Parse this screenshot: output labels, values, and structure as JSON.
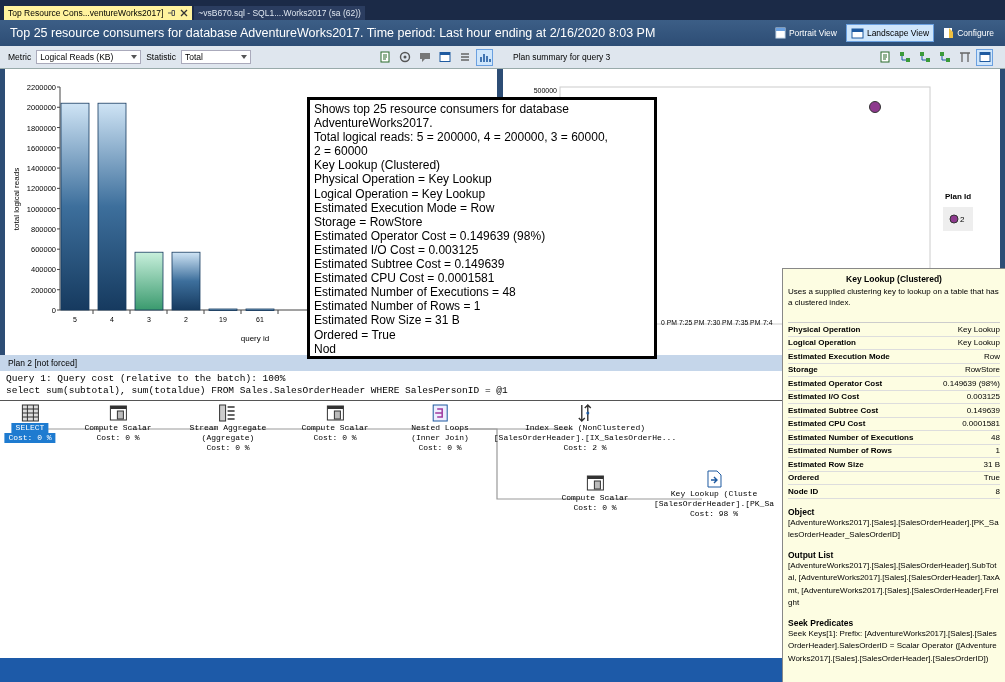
{
  "tabs": [
    {
      "label": "Top Resource Cons...ventureWorks2017]",
      "selected": true,
      "pinned": true,
      "closable": true
    },
    {
      "label": "~vsB670.sql - SQL1....Works2017 (sa (62))",
      "selected": false,
      "pinned": false,
      "closable": false
    }
  ],
  "header": {
    "title": "Top 25 resource consumers for database AdventureWorks2017. Time period: Last hour ending at 2/16/2020 8:03 PM",
    "views": [
      {
        "label": "Portrait View",
        "kind": "portrait",
        "selected": false
      },
      {
        "label": "Landscape View",
        "kind": "landscape",
        "selected": true
      },
      {
        "label": "Configure",
        "kind": "configure",
        "selected": false
      }
    ]
  },
  "toolbar": {
    "metric_label": "Metric",
    "metric_value": "Logical Reads (KB)",
    "statistic_label": "Statistic",
    "statistic_value": "Total",
    "left_tools": [
      {
        "kind": "document",
        "selected": false
      },
      {
        "kind": "target",
        "selected": false
      },
      {
        "kind": "speech",
        "selected": false
      },
      {
        "kind": "window",
        "selected": false
      },
      {
        "kind": "list",
        "selected": false
      },
      {
        "kind": "bar-chart",
        "selected": true
      }
    ],
    "plan_summary_title": "Plan summary for query 3",
    "right_tools": [
      {
        "kind": "document",
        "selected": false
      },
      {
        "kind": "network",
        "selected": false
      },
      {
        "kind": "network",
        "selected": false
      },
      {
        "kind": "network",
        "selected": false
      },
      {
        "kind": "split",
        "selected": false
      },
      {
        "kind": "window",
        "selected": true
      }
    ]
  },
  "bar_panel": {
    "selected_query": "3",
    "chart_data": {
      "type": "bar",
      "xlabel": "query id",
      "ylabel": "total logical reads",
      "categories": [
        "5",
        "4",
        "3",
        "2",
        "19",
        "61"
      ],
      "values": [
        2040000,
        2040000,
        570000,
        570000,
        10000,
        10000
      ],
      "ylim": [
        0,
        2200000
      ],
      "yticks": [
        0,
        200000,
        400000,
        600000,
        800000,
        1000000,
        1200000,
        1400000,
        1600000,
        1800000,
        2000000,
        2200000
      ]
    }
  },
  "plan_summary_panel": {
    "y_tick": "500000",
    "x_ticks": [
      "0 PM",
      "7:25 PM",
      "7:30 PM",
      "7:35 PM",
      "7:4"
    ],
    "legend_title": "Plan Id",
    "legend_items": [
      {
        "label": "2",
        "color": "#8e3a8e"
      }
    ]
  },
  "plan": {
    "title": "Plan 2 [not forced]",
    "query_lines": [
      "Query 1: Query cost (relative to the batch): 100%",
      "select sum(subtotal), sum(totaldue) FROM Sales.SalesOrderHeader WHERE SalesPersonID = @1"
    ],
    "nodes": [
      {
        "kind": "select",
        "lines": [
          "SELECT"
        ],
        "cost": "Cost: 0 %",
        "selected": true
      },
      {
        "kind": "compute-scalar",
        "lines": [
          "Compute Scalar"
        ],
        "cost": "Cost: 0 %",
        "selected": false
      },
      {
        "kind": "stream-aggregate",
        "lines": [
          "Stream Aggregate",
          "(Aggregate)"
        ],
        "cost": "Cost: 0 %",
        "selected": false
      },
      {
        "kind": "compute-scalar",
        "lines": [
          "Compute Scalar"
        ],
        "cost": "Cost: 0 %",
        "selected": false
      },
      {
        "kind": "nested-loops",
        "lines": [
          "Nested Loops",
          "(Inner Join)"
        ],
        "cost": "Cost: 0 %",
        "selected": false
      },
      {
        "kind": "index-seek",
        "lines": [
          "Index Seek (NonClustered)",
          "[SalesOrderHeader].[IX_SalesOrderHe..."
        ],
        "cost": "Cost: 2 %",
        "selected": false
      },
      {
        "kind": "compute-scalar",
        "lines": [
          "Compute Scalar"
        ],
        "cost": "Cost: 0 %",
        "selected": false
      },
      {
        "kind": "key-lookup",
        "lines": [
          "Key Lookup (Cluste",
          "[SalesOrderHeader].[PK_Sa"
        ],
        "cost": "Cost: 98 %",
        "selected": false
      }
    ]
  },
  "hover_tooltip": {
    "lines": [
      "Shows top 25 resource consumers for database",
      "AdventureWorks2017.",
      "Total logical reads: 5 = 200000, 4 = 200000, 3 = 60000,",
      "2 = 60000",
      "Key Lookup (Clustered)",
      "Physical Operation = Key Lookup",
      "Logical Operation = Key Lookup",
      "Estimated Execution Mode = Row",
      "Storage = RowStore",
      "Estimated Operator Cost = 0.149639 (98%)",
      "Estimated I/O Cost = 0.003125",
      "Estimated Subtree Cost = 0.149639",
      "Estimated CPU Cost = 0.0001581",
      "Estimated Number of Executions = 48",
      "Estimated Number of Rows = 1",
      "Estimated Row Size = 31 B",
      "Ordered = True",
      "Nod"
    ]
  },
  "operator_tooltip": {
    "title": "Key Lookup (Clustered)",
    "description": "Uses a supplied clustering key to lookup on a table that has a clustered index.",
    "properties": [
      {
        "name": "Physical Operation",
        "value": "Key Lookup"
      },
      {
        "name": "Logical Operation",
        "value": "Key Lookup"
      },
      {
        "name": "Estimated Execution Mode",
        "value": "Row"
      },
      {
        "name": "Storage",
        "value": "RowStore"
      },
      {
        "name": "Estimated Operator Cost",
        "value": "0.149639 (98%)"
      },
      {
        "name": "Estimated I/O Cost",
        "value": "0.003125"
      },
      {
        "name": "Estimated Subtree Cost",
        "value": "0.149639"
      },
      {
        "name": "Estimated CPU Cost",
        "value": "0.0001581"
      },
      {
        "name": "Estimated Number of Executions",
        "value": "48"
      },
      {
        "name": "Estimated Number of Rows",
        "value": "1"
      },
      {
        "name": "Estimated Row Size",
        "value": "31 B"
      },
      {
        "name": "Ordered",
        "value": "True"
      },
      {
        "name": "Node ID",
        "value": "8"
      }
    ],
    "sections": [
      {
        "title": "Object",
        "text": "[AdventureWorks2017].[Sales].[SalesOrderHeader].[PK_SalesOrderHeader_SalesOrderID]"
      },
      {
        "title": "Output List",
        "text": "[AdventureWorks2017].[Sales].[SalesOrderHeader].SubTotal, [AdventureWorks2017].[Sales].[SalesOrderHeader].TaxAmt, [AdventureWorks2017].[Sales].[SalesOrderHeader].Freight"
      },
      {
        "title": "Seek Predicates",
        "text": "Seek Keys[1]: Prefix: [AdventureWorks2017].[Sales].[SalesOrderHeader].SalesOrderID = Scalar Operator ([AdventureWorks2017].[Sales].[SalesOrderHeader].[SalesOrderID])"
      }
    ]
  }
}
